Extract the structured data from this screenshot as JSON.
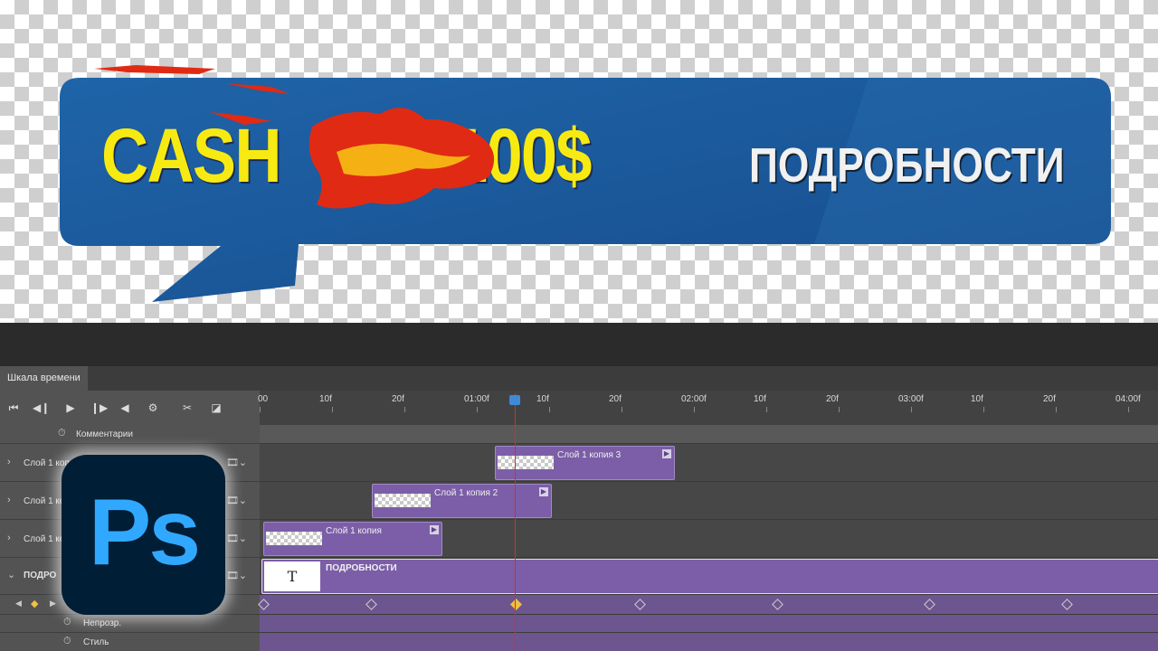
{
  "banner": {
    "promo_text": "CASH       T 100$",
    "cta_text": "ПОДРОБНОСТИ",
    "bg_color": "#1d5a9c",
    "promo_color": "#f7ea12"
  },
  "panel": {
    "tab_label": "Шкала времени"
  },
  "controls": [
    {
      "name": "go-to-first-frame-icon",
      "glyph": "⏮"
    },
    {
      "name": "previous-frame-icon",
      "glyph": "◀"
    },
    {
      "name": "play-icon",
      "glyph": "▶"
    },
    {
      "name": "next-frame-icon",
      "glyph": "▶"
    },
    {
      "name": "audio-icon",
      "glyph": "◀"
    },
    {
      "name": "settings-gear-icon",
      "glyph": "⚙"
    },
    {
      "name": "split-scissors-icon",
      "glyph": "✂"
    },
    {
      "name": "transition-icon",
      "glyph": "◪"
    }
  ],
  "ruler": {
    "ticks": [
      "00",
      "10f",
      "20f",
      "01:00f",
      "10f",
      "20f",
      "02:00f",
      "10f",
      "20f",
      "03:00f",
      "10f",
      "20f",
      "04:00f"
    ]
  },
  "layers": {
    "comments_label": "Комментарии",
    "layer1": "Слой 1 копи",
    "layer2": "Слой 1 ко",
    "layer3": "Слой 1 ко",
    "text_layer": "ПОДРО",
    "opacity_label": "Непрозр.",
    "style_label": "Стиль"
  },
  "clips": {
    "clip1": "Слой 1 копия 3",
    "clip2": "Слой 1 копия 2",
    "clip3": "Слой 1 копия",
    "text_clip": "ПОДРОБНОСТИ",
    "text_thumb": "T"
  },
  "logo": {
    "text": "Ps"
  },
  "colors": {
    "clip": "#7b5ea7",
    "playhead": "#d03030",
    "logo_bg": "#001e36",
    "logo_fg": "#31a8ff"
  }
}
